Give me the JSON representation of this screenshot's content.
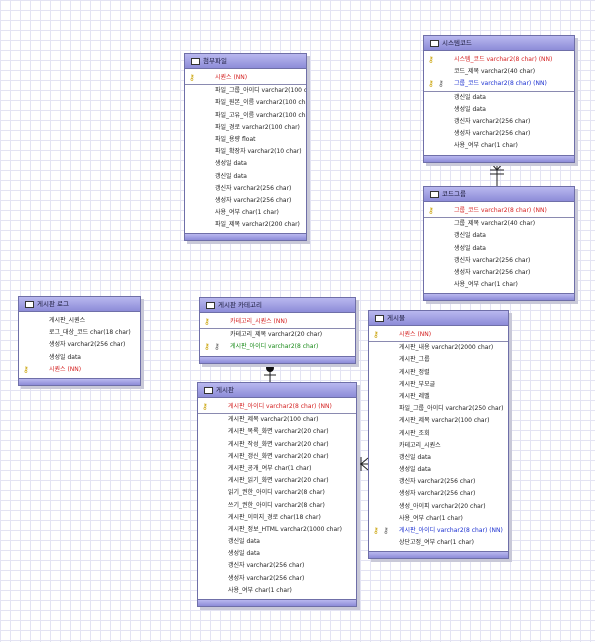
{
  "entities": {
    "attachment": {
      "title": "첨부파일",
      "rows": [
        {
          "text": "시퀀스 (NN)",
          "kind": "pk"
        },
        {
          "text": "파일_그룹_아이디 varchar2(100 char)"
        },
        {
          "text": "파일_원본_이름 varchar2(100 char)"
        },
        {
          "text": "파일_고유_이름 varchar2(100 char)"
        },
        {
          "text": "파일_경로 varchar2(100 char)"
        },
        {
          "text": "파일_용량 float"
        },
        {
          "text": "파일_확장자 varchar2(10 char)"
        },
        {
          "text": "생성일 data"
        },
        {
          "text": "갱신일 data"
        },
        {
          "text": "갱신자 varchar2(256 char)"
        },
        {
          "text": "생성자 varchar2(256 char)"
        },
        {
          "text": "사용_여부 char(1 char)"
        },
        {
          "text": "파일_제목 varchar2(200 char)"
        }
      ]
    },
    "system_code": {
      "title": "시스템코드",
      "rows": [
        {
          "text": "시스템_코드 varchar2(8 char) (NN)",
          "kind": "pk"
        },
        {
          "text": "코드_제목 varchar2(40 char)"
        },
        {
          "text": "그룹_코드 varchar2(8 char) (NN)",
          "kind": "fk"
        },
        {
          "text": "갱신일 data"
        },
        {
          "text": "생성일 data"
        },
        {
          "text": "갱신자 varchar2(256 char)"
        },
        {
          "text": "생성자 varchar2(256 char)"
        },
        {
          "text": "사용_여부 char(1 char)"
        }
      ]
    },
    "code_group": {
      "title": "코드그룹",
      "rows": [
        {
          "text": "그룹_코드 varchar2(8 char) (NN)",
          "kind": "pk"
        },
        {
          "text": "그룹_제목 varchar2(40 char)"
        },
        {
          "text": "갱신일 data"
        },
        {
          "text": "생성일 data"
        },
        {
          "text": "갱신자 varchar2(256 char)"
        },
        {
          "text": "생성자 varchar2(256 char)"
        },
        {
          "text": "사용_여부 char(1 char)"
        }
      ]
    },
    "board_log": {
      "title": "게시판 로그",
      "rows": [
        {
          "text": "게시판_시퀀스"
        },
        {
          "text": "로그_대상_코드 char(18 char)"
        },
        {
          "text": "생성자 varchar2(256 char)"
        },
        {
          "text": "생성일 data"
        },
        {
          "text": "시퀀스 (NN)",
          "kind": "pk"
        }
      ]
    },
    "board_category": {
      "title": "게시판 카테고리",
      "rows": [
        {
          "text": "카테고리_시퀀스 (NN)",
          "kind": "pk"
        },
        {
          "text": "카테고리_제목 varchar2(20 char)"
        },
        {
          "text": "게시판_아이디 varchar2(8 char)",
          "kind": "fk2"
        }
      ]
    },
    "board": {
      "title": "게시판",
      "rows": [
        {
          "text": "게시판_아이디 varchar2(8 char) (NN)",
          "kind": "pk"
        },
        {
          "text": "게시판_제목 varchar2(100 char)"
        },
        {
          "text": "게시판_목록_화면 varchar2(20 char)"
        },
        {
          "text": "게시판_작성_화면 varchar2(20 char)"
        },
        {
          "text": "게시판_갱신_화면 varchar2(20 char)"
        },
        {
          "text": "게시판_공개_여부 char(1 char)"
        },
        {
          "text": "게시판_읽기_화면 varchar2(20 char)"
        },
        {
          "text": "읽기_권한_아이디 varchar2(8 char)"
        },
        {
          "text": "쓰기_권한_아이디 varchar2(8 char)"
        },
        {
          "text": "게시판_이미지_경로 char(18 char)"
        },
        {
          "text": "게시판_정보_HTML varchar2(1000 char)"
        },
        {
          "text": "갱신일 data"
        },
        {
          "text": "생성일 data"
        },
        {
          "text": "갱신자 varchar2(256 char)"
        },
        {
          "text": "생성자 varchar2(256 char)"
        },
        {
          "text": "사용_여부 char(1 char)"
        }
      ]
    },
    "post": {
      "title": "게시물",
      "rows": [
        {
          "text": "시퀀스 (NN)",
          "kind": "pk"
        },
        {
          "text": "게시판_내용 varchar2(2000 char)"
        },
        {
          "text": "게시판_그룹"
        },
        {
          "text": "게시판_정렬"
        },
        {
          "text": "게시판_부모글"
        },
        {
          "text": "게시판_레벨"
        },
        {
          "text": "파일_그룹_아이디 varchar2(250 char)"
        },
        {
          "text": "게시판_제목 varchar2(100 char)"
        },
        {
          "text": "게시판_조회"
        },
        {
          "text": "카테고리_시퀀스"
        },
        {
          "text": "갱신일 data"
        },
        {
          "text": "생성일 data"
        },
        {
          "text": "갱신자 varchar2(256 char)"
        },
        {
          "text": "생성자 varchar2(256 char)"
        },
        {
          "text": "생성_아이피 varchar2(20 char)"
        },
        {
          "text": "사용_여부 char(1 char)"
        },
        {
          "text": "게시판_아이디 varchar2(8 char) (NN)",
          "kind": "fk"
        },
        {
          "text": "상단고정_여부 char(1 char)"
        }
      ]
    }
  }
}
